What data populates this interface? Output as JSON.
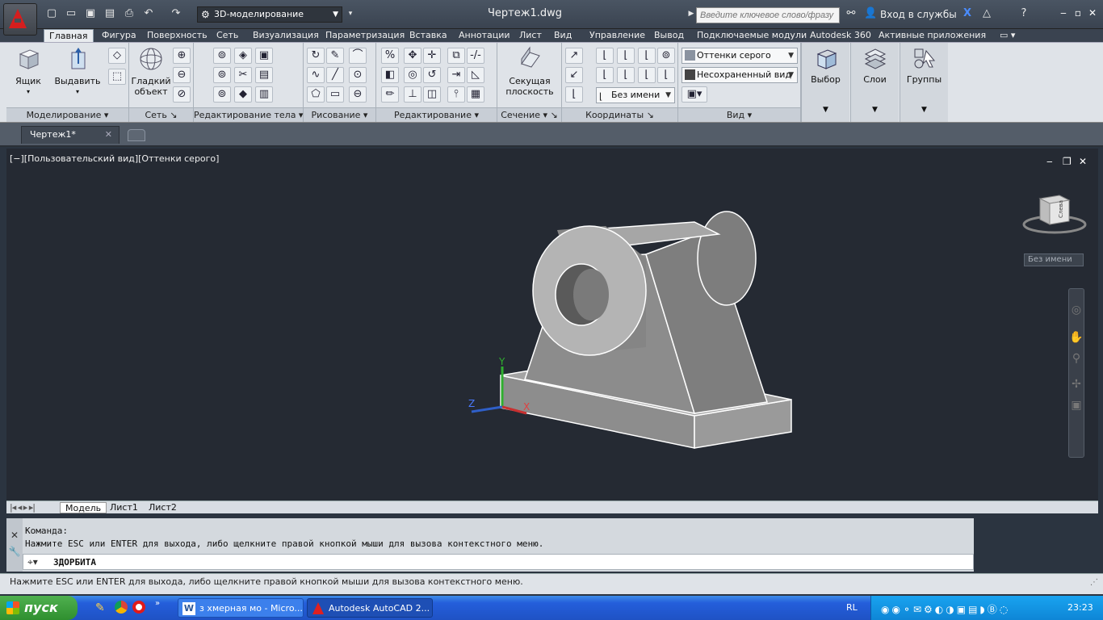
{
  "titlebar": {
    "workspace": "3D-моделирование",
    "doc_title": "Чертеж1.dwg",
    "search_placeholder": "Введите ключевое слово/фразу",
    "signin": "Вход в службы"
  },
  "tabs": [
    "Главная",
    "Фигура",
    "Поверхность",
    "Сеть",
    "Визуализация",
    "Параметризация",
    "Вставка",
    "Аннотации",
    "Лист",
    "Вид",
    "Управление",
    "Вывод",
    "Подключаемые модули",
    "Autodesk 360",
    "Активные приложения"
  ],
  "ribbon": {
    "box_label": "Ящик",
    "extrude_label": "Выдавить",
    "smooth_label": "Гладкий объект",
    "section_label": "Секущая плоскость",
    "select_label": "Выбор",
    "layers_label": "Слои",
    "groups_label": "Группы",
    "visual_style": "Оттенки серого",
    "view_combo": "Несохраненный вид",
    "ucs_combo": "Без имени",
    "panels": {
      "modeling": "Моделирование",
      "mesh": "Сеть",
      "solid_edit": "Редактирование тела",
      "draw": "Рисование",
      "modify": "Редактирование",
      "section": "Сечение",
      "coordinates": "Координаты",
      "view": "Вид"
    }
  },
  "file_tab": "Чертеж1*",
  "viewport": {
    "label": "[−][Пользовательский вид][Оттенки серого]",
    "named_view": "Без имени",
    "viewcube_text": "Слева"
  },
  "layout_tabs": [
    "Модель",
    "Лист1",
    "Лист2"
  ],
  "command": {
    "line1": "Команда:",
    "line2": "Нажмите ESC или ENTER для выхода, либо щелкните правой кнопкой мыши для вызова контекстного меню.",
    "prompt": "3ДОРБИТА"
  },
  "status_text": "Нажмите ESC или ENTER для выхода, либо щелкните правой кнопкой мыши для вызова контекстного меню.",
  "taskbar": {
    "start": "пуск",
    "task1": "з хмерная мо - Micro...",
    "task2": "Autodesk AutoCAD 2...",
    "lang": "RL",
    "clock": "23:23"
  },
  "ucs_axes": {
    "x": "X",
    "y": "Y",
    "z": "Z"
  }
}
